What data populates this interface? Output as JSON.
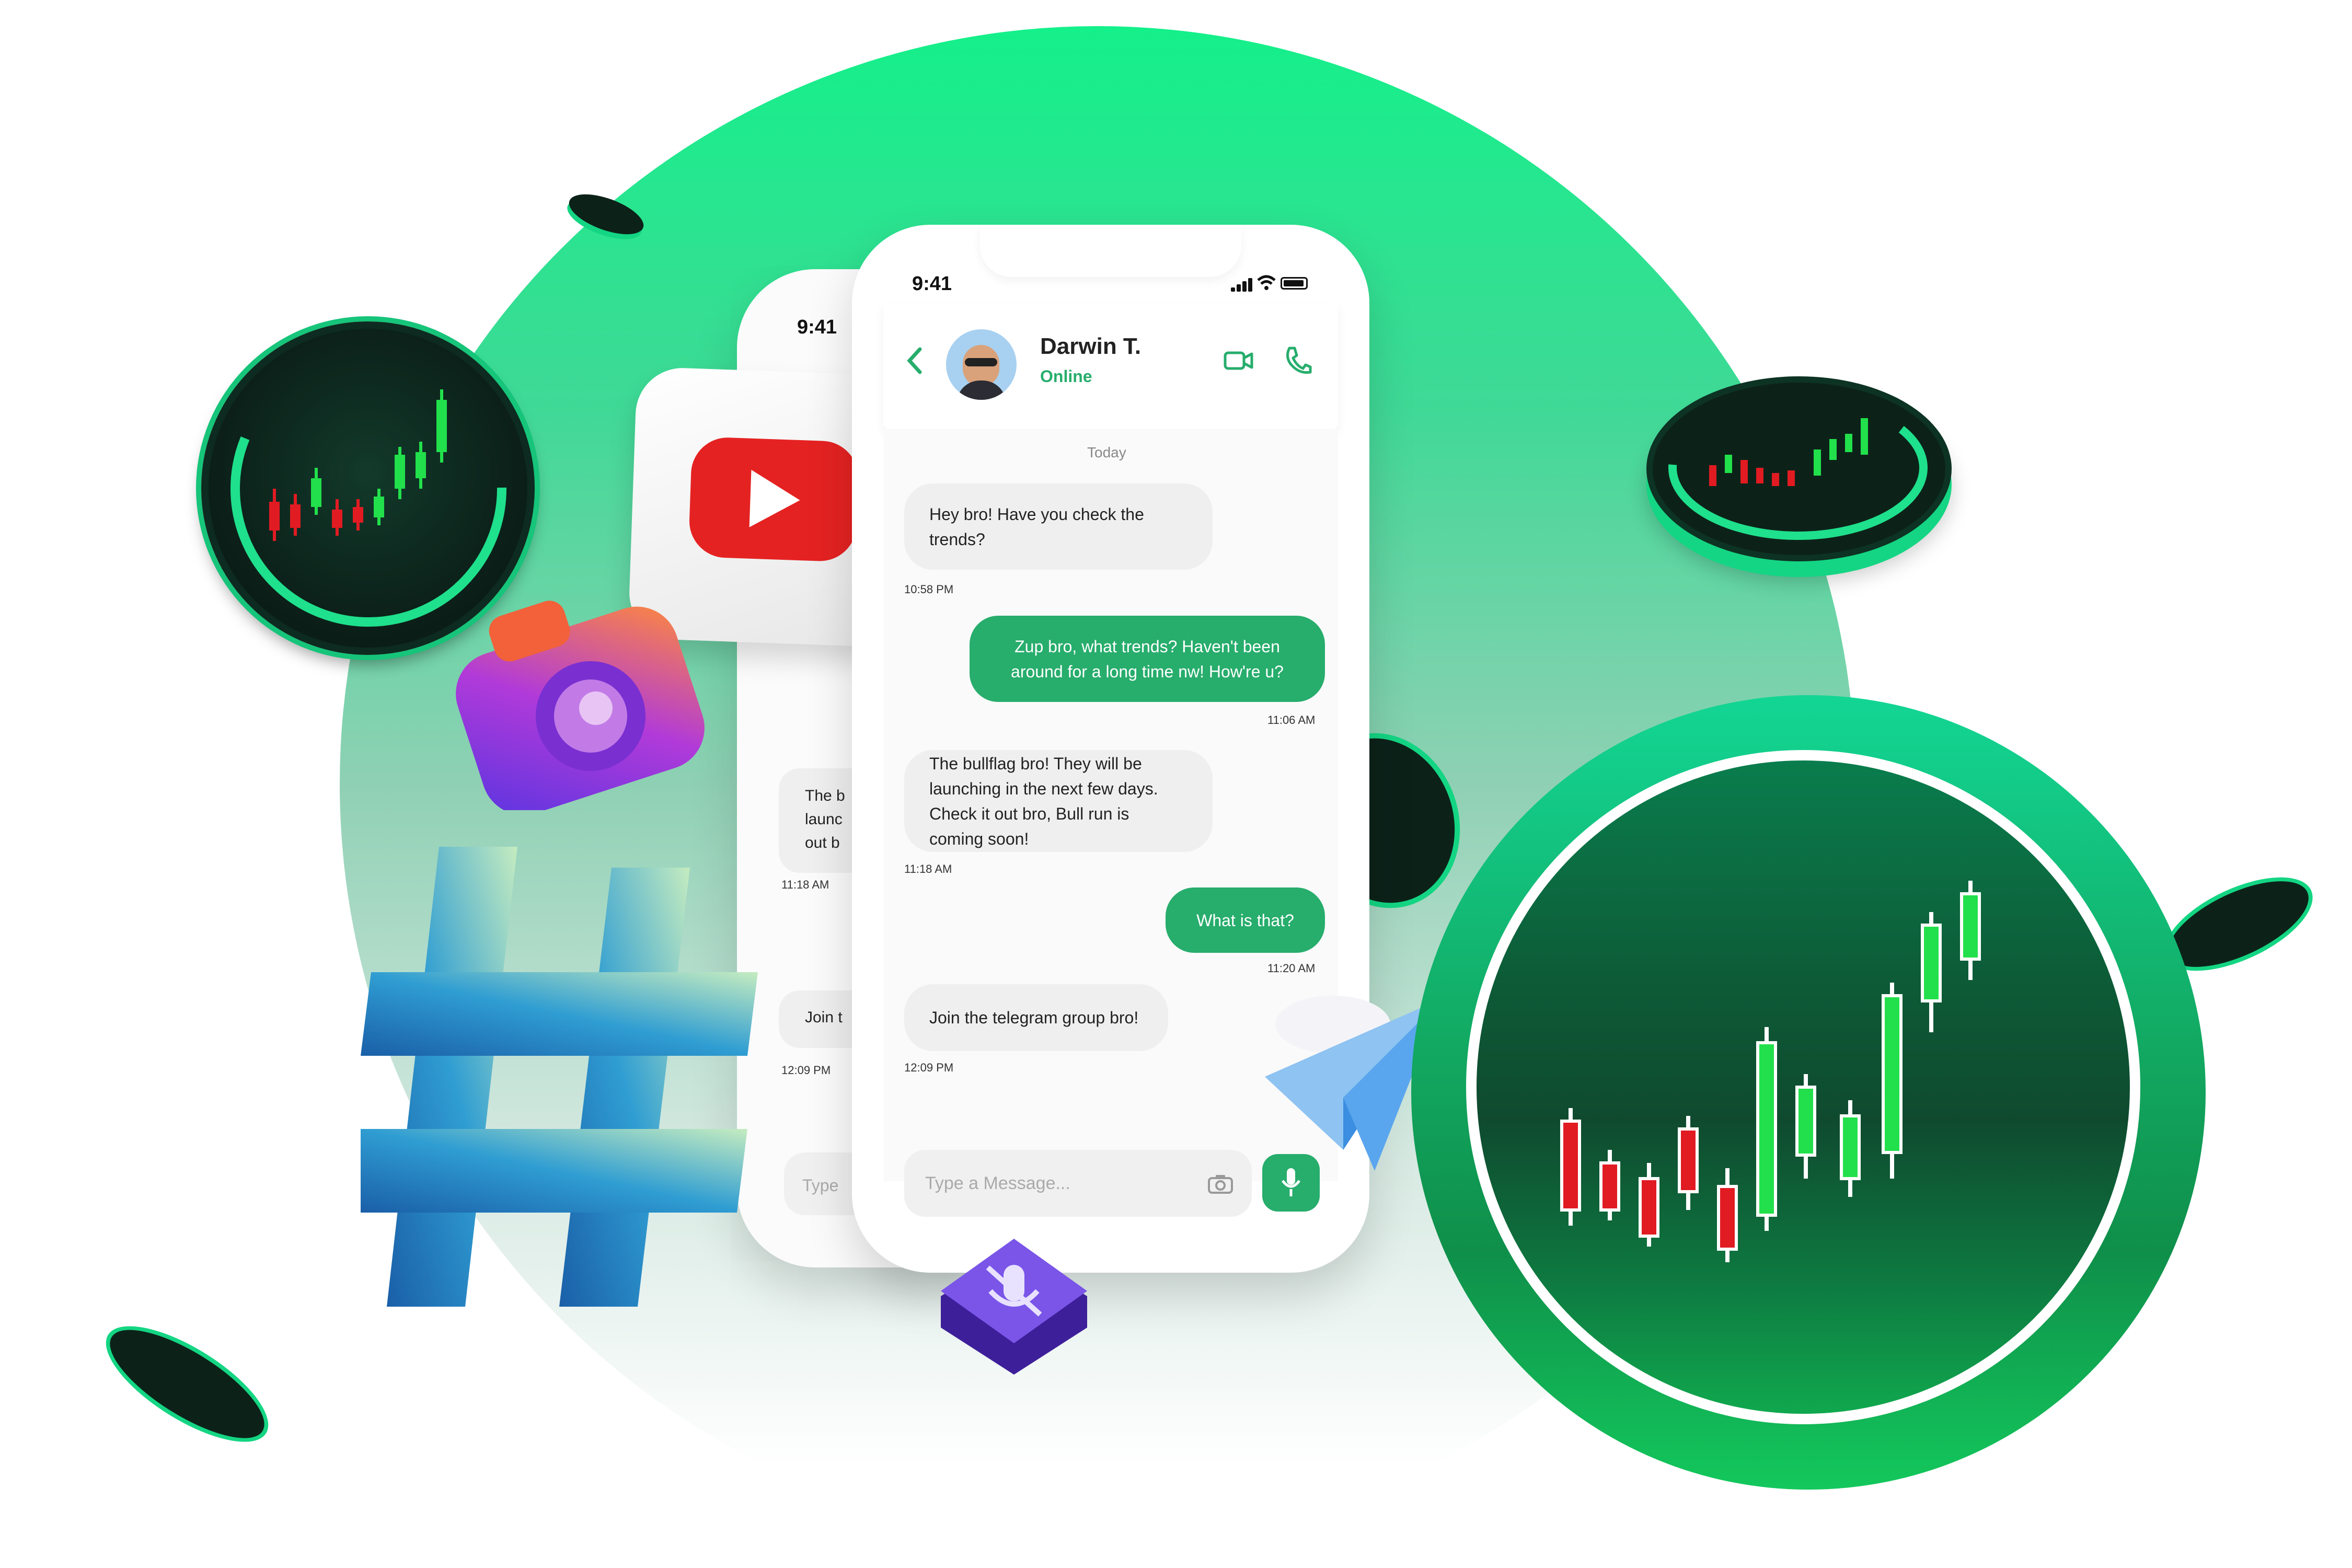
{
  "phone_back": {
    "time": "9:41",
    "messages": [
      {
        "text": "The b\nlaunc\nout b",
        "time": "11:18 AM"
      },
      {
        "text": "Join t",
        "time": "12:09 PM"
      }
    ],
    "input_placeholder": "Type"
  },
  "phone_main": {
    "status_time": "9:41",
    "contact": {
      "name": "Darwin T.",
      "status": "Online"
    },
    "day_label": "Today",
    "messages": [
      {
        "direction": "in",
        "text": "Hey bro! Have you check the trends?",
        "time": "10:58 PM"
      },
      {
        "direction": "out",
        "text": "Zup bro, what trends? Haven't been around for a long time nw! How're u?",
        "time": "11:06 AM"
      },
      {
        "direction": "in",
        "text": "The bullflag bro! They will be launching in the next few days. Check it out bro, Bull run is coming soon!",
        "time": "11:18 AM"
      },
      {
        "direction": "out",
        "text": "What is that?",
        "time": "11:20 AM"
      },
      {
        "direction": "in",
        "text": "Join the telegram group bro!",
        "time": "12:09 PM"
      }
    ],
    "input_placeholder": "Type a Message..."
  },
  "icons": [
    "back-arrow-icon",
    "video-call-icon",
    "phone-call-icon",
    "camera-icon",
    "microphone-icon",
    "youtube-logo-icon",
    "instagram-camera-icon",
    "hashtag-icon",
    "paper-plane-icon",
    "chart-coin-icon"
  ],
  "colors": {
    "accent_green": "#27ad6c",
    "bg_gradient_top": "#14f08a",
    "candle_up": "#22e04b",
    "candle_down": "#e11b22"
  }
}
